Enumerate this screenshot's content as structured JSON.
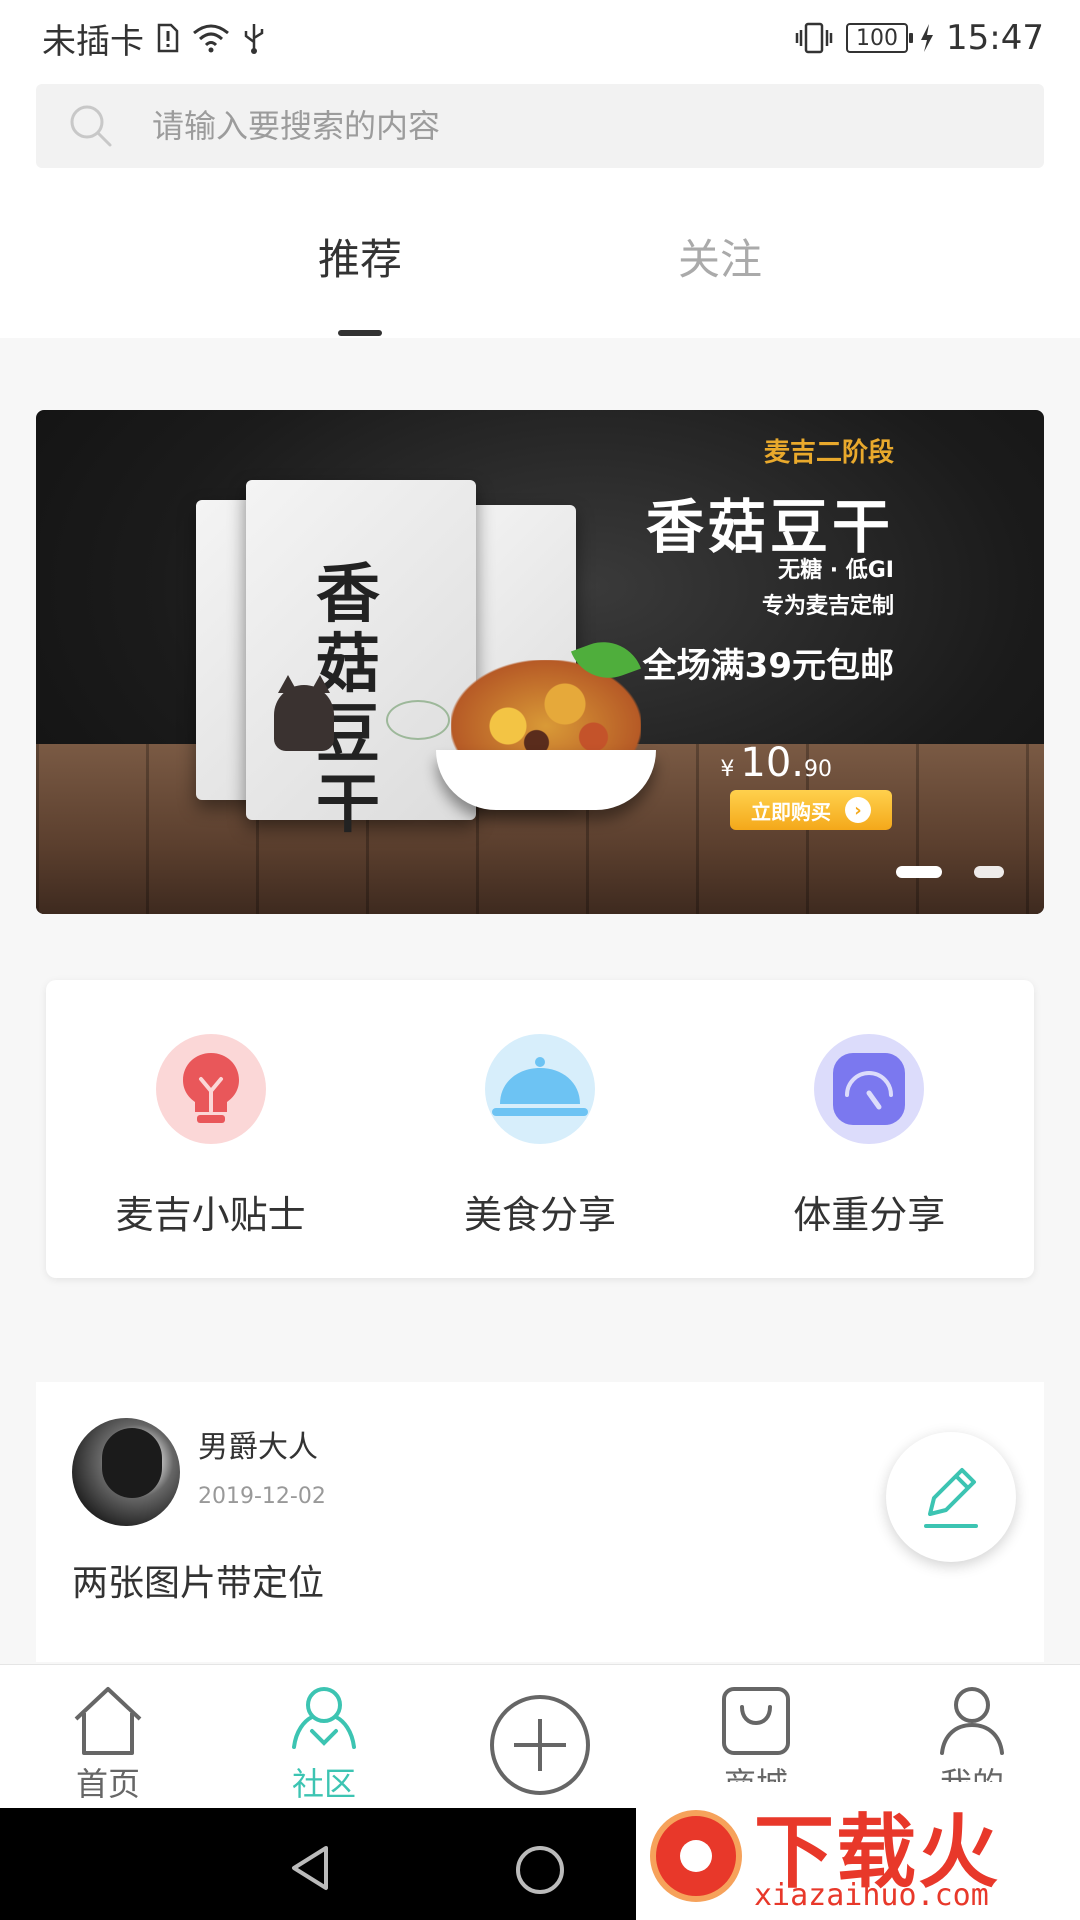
{
  "status_bar": {
    "carrier": "未插卡",
    "battery": "100",
    "time": "15:47"
  },
  "search": {
    "placeholder": "请输入要搜索的内容"
  },
  "tabs": [
    {
      "label": "推荐",
      "active": true
    },
    {
      "label": "关注",
      "active": false
    }
  ],
  "banner": {
    "stage": "麦吉二阶段",
    "title": "香菇豆干",
    "subtitle1": "无糖 · 低GI",
    "subtitle2": "专为麦吉定制",
    "promo": "全场满39元包邮",
    "price_currency": "¥",
    "price_int": "10.",
    "price_dec": "90",
    "buy_label": "立即购买",
    "product_text": "香菇豆干",
    "active_slide": 1,
    "slides": 2
  },
  "categories": [
    {
      "label": "麦吉小贴士",
      "icon": "lightbulb-icon",
      "bg": "#fbd7d7",
      "fg": "#e9575a"
    },
    {
      "label": "美食分享",
      "icon": "food-cloche-icon",
      "bg": "#d7eefb",
      "fg": "#6dc3f3"
    },
    {
      "label": "体重分享",
      "icon": "scale-icon",
      "bg": "#dcdcfb",
      "fg": "#7b78ef"
    }
  ],
  "post": {
    "author": "男爵大人",
    "date": "2019-12-02",
    "text": "两张图片带定位"
  },
  "bottom_nav": [
    {
      "label": "首页",
      "icon": "home-icon",
      "active": false
    },
    {
      "label": "社区",
      "icon": "community-icon",
      "active": true
    },
    {
      "label": "",
      "icon": "add-circle-icon",
      "active": false
    },
    {
      "label": "商城",
      "icon": "shop-bag-icon",
      "active": false
    },
    {
      "label": "我的",
      "icon": "profile-icon",
      "active": false
    }
  ],
  "watermark": {
    "text": "下载火",
    "url": "xiazaihuo.com"
  },
  "colors": {
    "accent": "#3cc4b2",
    "text": "#333333",
    "muted": "#999999"
  }
}
